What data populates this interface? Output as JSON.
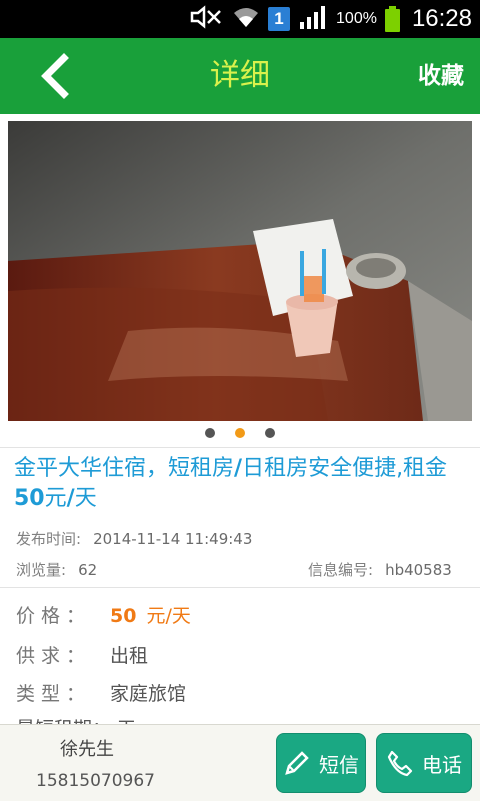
{
  "status_bar": {
    "sim_label": "1",
    "battery_percent": "100%",
    "time": "16:28"
  },
  "header": {
    "title": "详细",
    "favorite_label": "收藏"
  },
  "carousel": {
    "dot_count": 3,
    "active_index": 1
  },
  "listing": {
    "title_part1": "金平大华住宿，短租房",
    "title_slash1": "/",
    "title_part2": "日租房安全便捷,租金",
    "title_price": "50",
    "title_part3": "元",
    "title_slash2": "/",
    "title_part4": "天",
    "publish_label": "发布时间:",
    "publish_time": "2014-11-14 11:49:43",
    "views_label": "浏览量:",
    "views": "62",
    "info_id_label": "信息编号:",
    "info_id": "hb40583"
  },
  "details": {
    "price_label": "价格：",
    "price_value": "50",
    "price_unit": "元/天",
    "supply_label": "供求：",
    "supply_value": "出租",
    "type_label": "类型：",
    "type_value": "家庭旅馆",
    "cut_row_text": "最短租期：  天"
  },
  "bottom_bar": {
    "contact_name": "徐先生",
    "contact_phone": "15815070967",
    "sms_label": "短信",
    "call_label": "电话"
  },
  "colors": {
    "header_bg": "#19a03a",
    "title_color": "#d9f14c",
    "link_blue": "#1e9bd6",
    "price_orange": "#f07a15",
    "button_green": "#1aa883"
  }
}
